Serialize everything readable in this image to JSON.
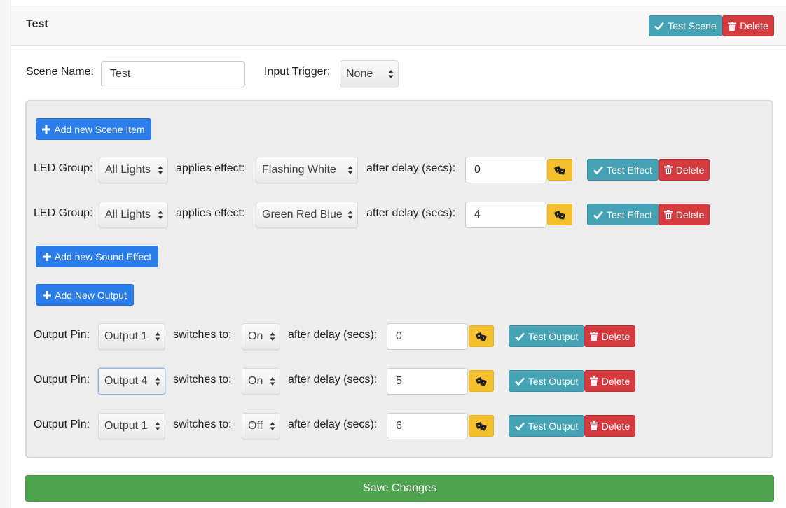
{
  "scene": {
    "title": "Test",
    "test_scene_label": "Test Scene",
    "delete_label": "Delete",
    "name_label": "Scene Name:",
    "name_value": "Test",
    "trigger_label": "Input Trigger:",
    "trigger_value": "None"
  },
  "buttons": {
    "add_scene_item": "Add new Scene Item",
    "add_sound_effect": "Add new Sound Effect",
    "add_output": "Add New Output",
    "save": "Save Changes"
  },
  "led_items": [
    {
      "group_label": "LED Group:",
      "group": "All Lights",
      "effect_label": "applies effect:",
      "effect": "Flashing White",
      "delay_label": "after delay (secs):",
      "delay": "0",
      "test_label": "Test Effect",
      "delete_label": "Delete"
    },
    {
      "group_label": "LED Group:",
      "group": "All Lights",
      "effect_label": "applies effect:",
      "effect": "Green Red Blue",
      "delay_label": "after delay (secs):",
      "delay": "4",
      "test_label": "Test Effect",
      "delete_label": "Delete"
    }
  ],
  "outputs": [
    {
      "pin_label": "Output Pin:",
      "pin": "Output 1",
      "switch_label": "switches to:",
      "state": "On",
      "delay_label": "after delay (secs):",
      "delay": "0",
      "test_label": "Test Output",
      "delete_label": "Delete"
    },
    {
      "pin_label": "Output Pin:",
      "pin": "Output 4",
      "switch_label": "switches to:",
      "state": "On",
      "delay_label": "after delay (secs):",
      "delay": "5",
      "test_label": "Test Output",
      "delete_label": "Delete"
    },
    {
      "pin_label": "Output Pin:",
      "pin": "Output 1",
      "switch_label": "switches to:",
      "state": "Off",
      "delay_label": "after delay (secs):",
      "delay": "6",
      "test_label": "Test Output",
      "delete_label": "Delete"
    }
  ],
  "icons": {
    "check": "check-icon",
    "trash": "trash-icon",
    "plus": "plus-icon",
    "dice": "dice-icon",
    "select_arrows": "select-arrows-icon"
  },
  "colors": {
    "info": "#46a3b5",
    "danger": "#d33b3f",
    "primary": "#2b7de9",
    "warning": "#f5c02e",
    "success": "#4fa54f"
  }
}
